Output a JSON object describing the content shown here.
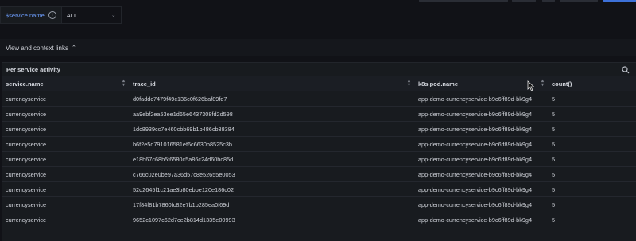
{
  "variable": {
    "name": "$service.name",
    "value": "ALL"
  },
  "context_links_label": "View and context links",
  "panel": {
    "title": "Per service activity",
    "columns": [
      "service.name",
      "trace_id",
      "k8s.pod.name",
      "count()"
    ],
    "rows": [
      [
        "currencyservice",
        "d0faddc7479f49c136c0f626baf89fd7",
        "app-demo-currencyservice-b9c6ff89d-bk9g4",
        "5"
      ],
      [
        "currencyservice",
        "aa9ebf2ea53ee1d65e6437308fd2d598",
        "app-demo-currencyservice-b9c6ff89d-bk9g4",
        "5"
      ],
      [
        "currencyservice",
        "1dc8939cc7e460cbb69b1b486cb38384",
        "app-demo-currencyservice-b9c6ff89d-bk9g4",
        "5"
      ],
      [
        "currencyservice",
        "b6f2e5d791016581ef6c6630b8525c3b",
        "app-demo-currencyservice-b9c6ff89d-bk9g4",
        "5"
      ],
      [
        "currencyservice",
        "e18b67c68b5f6580c5a86c24d60bc85d",
        "app-demo-currencyservice-b9c6ff89d-bk9g4",
        "5"
      ],
      [
        "currencyservice",
        "c766c02e0be97a36d57c8e52655e0053",
        "app-demo-currencyservice-b9c6ff89d-bk9g4",
        "5"
      ],
      [
        "currencyservice",
        "52d2645f1c21ae3b80ebbe120e186c02",
        "app-demo-currencyservice-b9c6ff89d-bk9g4",
        "5"
      ],
      [
        "currencyservice",
        "17f84f81b7860fc82e7b1b285ea0f69d",
        "app-demo-currencyservice-b9c6ff89d-bk9g4",
        "5"
      ],
      [
        "currencyservice",
        "9652c1097c62d7ce2b814d1335e00993",
        "app-demo-currencyservice-b9c6ff89d-bk9g4",
        "5"
      ]
    ]
  },
  "colors": {
    "background": "#111217",
    "panel": "#181b1f",
    "accent": "#3d71d9",
    "variable_label": "#6e9fff"
  }
}
